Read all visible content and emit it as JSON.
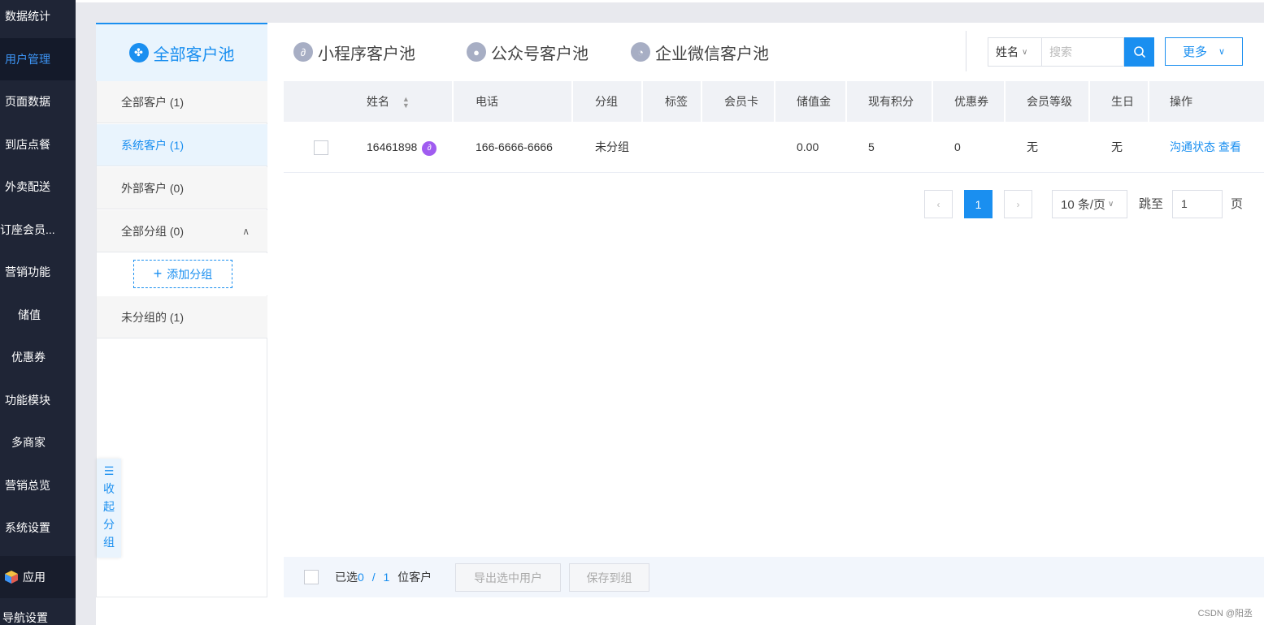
{
  "nav": {
    "items": [
      {
        "label": "数据统计"
      },
      {
        "label": "用户管理",
        "active": true
      },
      {
        "label": "页面数据"
      },
      {
        "label": "到店点餐"
      },
      {
        "label": "外卖配送"
      },
      {
        "label": "订座会员..."
      },
      {
        "label": "营销功能"
      },
      {
        "label": "储值"
      },
      {
        "label": "优惠券"
      },
      {
        "label": "功能模块"
      },
      {
        "label": "多商家"
      },
      {
        "label": "营销总览"
      },
      {
        "label": "系统设置"
      }
    ],
    "apps_label": "应用",
    "nav_settings_label": "导航设置"
  },
  "tabs": {
    "active": {
      "label": "全部客户池",
      "icon": "grid-icon"
    },
    "items": [
      {
        "label": "小程序客户池",
        "icon": "miniprogram-icon"
      },
      {
        "label": "公众号客户池",
        "icon": "user-icon"
      },
      {
        "label": "企业微信客户池",
        "icon": "wecom-icon"
      }
    ]
  },
  "search": {
    "field_select": "姓名",
    "placeholder": "搜索",
    "more_label": "更多"
  },
  "groups": {
    "items": [
      {
        "label": "全部客户 (1)"
      },
      {
        "label": "系统客户 (1)",
        "active": true
      },
      {
        "label": "外部客户 (0)"
      },
      {
        "label": "全部分组 (0)"
      },
      {
        "label": "未分组的 (1)"
      }
    ],
    "add_group_label": "添加分组",
    "collapse_chars": [
      "收",
      "起",
      "分",
      "组"
    ]
  },
  "table": {
    "columns": [
      "姓名",
      "电话",
      "分组",
      "标签",
      "会员卡",
      "储值金",
      "现有积分",
      "优惠券",
      "会员等级",
      "生日",
      "操作"
    ],
    "rows": [
      {
        "name": "16461898",
        "phone": "166-6666-6666",
        "group": "未分组",
        "tag": "",
        "member_card": "",
        "balance": "0.00",
        "points": "5",
        "coupons": "0",
        "level": "无",
        "birthday": "无",
        "action_status": "沟通状态",
        "action_view": "查看"
      }
    ]
  },
  "pagination": {
    "current_page": "1",
    "page_size": "10 条/页",
    "jump_label": "跳至",
    "jump_value": "1",
    "page_unit": "页"
  },
  "footer": {
    "selected_prefix": "已选",
    "selected_count": "0",
    "separator": "/",
    "total_count": "1",
    "selected_suffix": "位客户",
    "export_label": "导出选中用户",
    "save_label": "保存到组"
  },
  "watermark": "CSDN @阳丞",
  "colors": {
    "accent": "#1a8ff0",
    "nav_bg": "#1f2536"
  }
}
